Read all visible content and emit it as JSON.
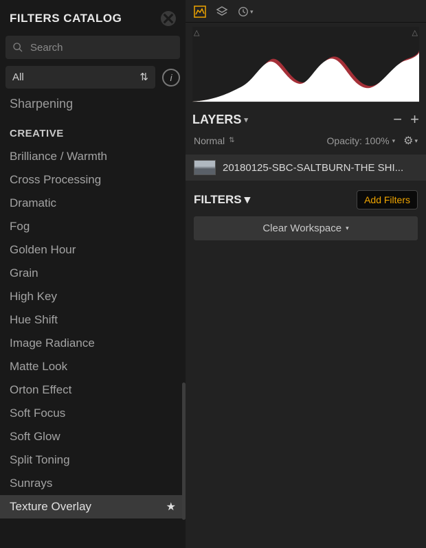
{
  "leftPanel": {
    "title": "FILTERS CATALOG",
    "searchPlaceholder": "Search",
    "categoryDropdown": "All",
    "truncatedTopItem": "Sharpening",
    "sectionHeader": "CREATIVE",
    "filters": [
      "Brilliance / Warmth",
      "Cross Processing",
      "Dramatic",
      "Fog",
      "Golden Hour",
      "Grain",
      "High Key",
      "Hue Shift",
      "Image Radiance",
      "Matte Look",
      "Orton Effect",
      "Soft Focus",
      "Soft Glow",
      "Split Toning",
      "Sunrays",
      "Texture Overlay"
    ],
    "selectedFilter": "Texture Overlay"
  },
  "rightPanel": {
    "layers": {
      "title": "LAYERS",
      "blendMode": "Normal",
      "opacityLabel": "Opacity: 100%",
      "layerName": "20180125-SBC-SALTBURN-THE SHI..."
    },
    "filters": {
      "title": "FILTERS",
      "addButton": "Add Filters",
      "clearButton": "Clear Workspace"
    }
  }
}
